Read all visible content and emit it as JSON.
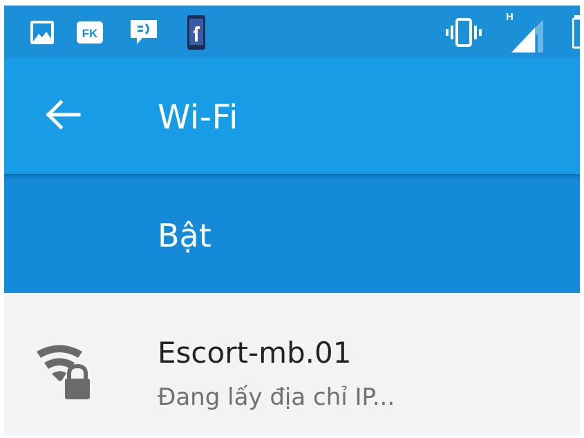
{
  "status_bar": {
    "network_type": "H",
    "icons": {
      "gallery": "image-notification-icon",
      "fk": "fk-app-notification-icon",
      "chat": "chat-notification-icon",
      "facebook": "facebook-notification-icon",
      "vibrate": "vibrate-mode-icon",
      "signal": "cellular-signal-icon",
      "battery": "battery-icon"
    },
    "fk_badge": "FK"
  },
  "app_bar": {
    "title": "Wi-Fi",
    "back_icon": "arrow-left-icon"
  },
  "wifi_switch": {
    "label": "Bật"
  },
  "networks": [
    {
      "ssid": "Escort-mb.01",
      "status": "Đang lấy địa chỉ IP...",
      "icon": "wifi-lock-icon"
    }
  ],
  "colors": {
    "status_bar": "#1b8fd8",
    "app_bar": "#199ce6",
    "switch_bar": "#158ad8",
    "list_bg": "#f3f3f3"
  }
}
